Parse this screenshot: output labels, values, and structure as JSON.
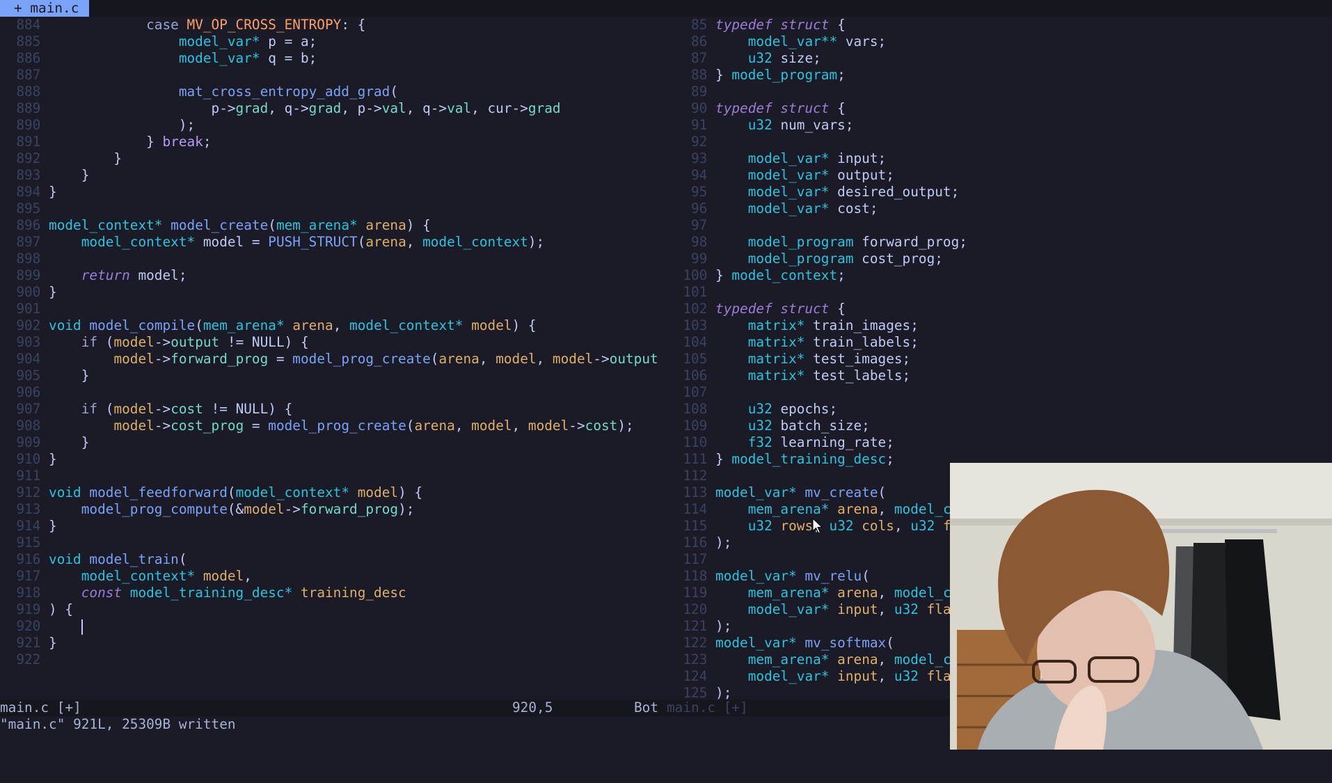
{
  "tab": {
    "label": "+ main.c"
  },
  "left_pane": {
    "lines": [
      {
        "n": "884",
        "code": "            ⟦kw|case⟧ ⟦c|MV_OP_CROSS_ENTROPY⟧: {"
      },
      {
        "n": "885",
        "code": "                ⟦t|model_var*⟧ p = a;"
      },
      {
        "n": "886",
        "code": "                ⟦t|model_var*⟧ q = b;"
      },
      {
        "n": "887",
        "code": ""
      },
      {
        "n": "888",
        "code": "                ⟦f|mat_cross_entropy_add_grad⟧("
      },
      {
        "n": "889",
        "code": "                    p->⟦m|grad⟧, q->⟦m|grad⟧, p->⟦m|val⟧, q->⟦m|val⟧, cur->⟦m|grad⟧"
      },
      {
        "n": "890",
        "code": "                );"
      },
      {
        "n": "891",
        "code": "            } ⟦b|break⟧;"
      },
      {
        "n": "892",
        "code": "        }"
      },
      {
        "n": "893",
        "code": "    }"
      },
      {
        "n": "894",
        "code": "}"
      },
      {
        "n": "895",
        "code": ""
      },
      {
        "n": "896",
        "code": "⟦t|model_context*⟧ ⟦f|model_create⟧(⟦t|mem_arena*⟧ ⟦v|arena⟧) {"
      },
      {
        "n": "897",
        "code": "    ⟦t|model_context*⟧ model = ⟦f|PUSH_STRUCT⟧(⟦v|arena⟧, ⟦t|model_context⟧);"
      },
      {
        "n": "898",
        "code": ""
      },
      {
        "n": "899",
        "code": "    ⟦k|return⟧ model;"
      },
      {
        "n": "900",
        "code": "}"
      },
      {
        "n": "901",
        "code": ""
      },
      {
        "n": "902",
        "code": "⟦t|void⟧ ⟦f|model_compile⟧(⟦t|mem_arena*⟧ ⟦v|arena⟧, ⟦t|model_context*⟧ ⟦v|model⟧) {"
      },
      {
        "n": "903",
        "code": "    ⟦kw|if⟧ (⟦v|model⟧->⟦m|output⟧ != NULL) {"
      },
      {
        "n": "904",
        "code": "        ⟦v|model⟧->⟦m|forward_prog⟧ = ⟦f|model_prog_create⟧(⟦v|arena⟧, ⟦v|model⟧, ⟦v|model⟧->⟦m|output⟧"
      },
      {
        "n": "905",
        "code": "    }"
      },
      {
        "n": "906",
        "code": ""
      },
      {
        "n": "907",
        "code": "    ⟦kw|if⟧ (⟦v|model⟧->⟦m|cost⟧ != NULL) {"
      },
      {
        "n": "908",
        "code": "        ⟦v|model⟧->⟦m|cost_prog⟧ = ⟦f|model_prog_create⟧(⟦v|arena⟧, ⟦v|model⟧, ⟦v|model⟧->⟦m|cost⟧);"
      },
      {
        "n": "909",
        "code": "    }"
      },
      {
        "n": "910",
        "code": "}"
      },
      {
        "n": "911",
        "code": ""
      },
      {
        "n": "912",
        "code": "⟦t|void⟧ ⟦f|model_feedforward⟧(⟦t|model_context*⟧ ⟦v|model⟧) {"
      },
      {
        "n": "913",
        "code": "    ⟦f|model_prog_compute⟧(&⟦v|model⟧->⟦m|forward_prog⟧);"
      },
      {
        "n": "914",
        "code": "}"
      },
      {
        "n": "915",
        "code": ""
      },
      {
        "n": "916",
        "code": "⟦t|void⟧ ⟦f|model_train⟧("
      },
      {
        "n": "917",
        "code": "    ⟦t|model_context*⟧ ⟦v|model⟧,"
      },
      {
        "n": "918",
        "code": "    ⟦k|const⟧ ⟦t|model_training_desc*⟧ ⟦v|training_desc⟧"
      },
      {
        "n": "919",
        "code": ") {"
      },
      {
        "n": "920",
        "code": "    ",
        "cursor": true
      },
      {
        "n": "921",
        "code": "}"
      },
      {
        "n": "922",
        "code": ""
      }
    ]
  },
  "right_pane": {
    "lines": [
      {
        "n": "85",
        "code": "⟦k|typedef struct⟧ {"
      },
      {
        "n": "86",
        "code": "    ⟦t|model_var**⟧ vars;"
      },
      {
        "n": "87",
        "code": "    ⟦t|u32⟧ size;"
      },
      {
        "n": "88",
        "code": "} ⟦t|model_program⟧;"
      },
      {
        "n": "89",
        "code": ""
      },
      {
        "n": "90",
        "code": "⟦k|typedef struct⟧ {"
      },
      {
        "n": "91",
        "code": "    ⟦t|u32⟧ num_vars;"
      },
      {
        "n": "92",
        "code": ""
      },
      {
        "n": "93",
        "code": "    ⟦t|model_var*⟧ input;"
      },
      {
        "n": "94",
        "code": "    ⟦t|model_var*⟧ output;"
      },
      {
        "n": "95",
        "code": "    ⟦t|model_var*⟧ desired_output;"
      },
      {
        "n": "96",
        "code": "    ⟦t|model_var*⟧ cost;"
      },
      {
        "n": "97",
        "code": ""
      },
      {
        "n": "98",
        "code": "    ⟦t|model_program⟧ forward_prog;"
      },
      {
        "n": "99",
        "code": "    ⟦t|model_program⟧ cost_prog;"
      },
      {
        "n": "100",
        "code": "} ⟦t|model_context⟧;"
      },
      {
        "n": "101",
        "code": ""
      },
      {
        "n": "102",
        "code": "⟦k|typedef struct⟧ {"
      },
      {
        "n": "103",
        "code": "    ⟦t|matrix*⟧ train_images;"
      },
      {
        "n": "104",
        "code": "    ⟦t|matrix*⟧ train_labels;"
      },
      {
        "n": "105",
        "code": "    ⟦t|matrix*⟧ test_images;"
      },
      {
        "n": "106",
        "code": "    ⟦t|matrix*⟧ test_labels;"
      },
      {
        "n": "107",
        "code": ""
      },
      {
        "n": "108",
        "code": "    ⟦t|u32⟧ epochs;"
      },
      {
        "n": "109",
        "code": "    ⟦t|u32⟧ batch_size;"
      },
      {
        "n": "110",
        "code": "    ⟦t|f32⟧ learning_rate;"
      },
      {
        "n": "111",
        "code": "} ⟦t|model_training_desc⟧;"
      },
      {
        "n": "112",
        "code": ""
      },
      {
        "n": "113",
        "code": "⟦t|model_var*⟧ ⟦f|mv_create⟧("
      },
      {
        "n": "114",
        "code": "    ⟦t|mem_arena*⟧ ⟦v|arena⟧, ⟦t|model_c⟧"
      },
      {
        "n": "115",
        "code": "    ⟦t|u32⟧ ⟦v|rows⟧, ⟦t|u32⟧ ⟦v|cols⟧, ⟦t|u32⟧ ⟦v|f⟧"
      },
      {
        "n": "116",
        "code": ");"
      },
      {
        "n": "117",
        "code": ""
      },
      {
        "n": "118",
        "code": "⟦t|model_var*⟧ ⟦f|mv_relu⟧("
      },
      {
        "n": "119",
        "code": "    ⟦t|mem_arena*⟧ ⟦v|arena⟧, ⟦t|model_c⟧"
      },
      {
        "n": "120",
        "code": "    ⟦t|model_var*⟧ ⟦v|input⟧, ⟦t|u32⟧ ⟦v|fla⟧"
      },
      {
        "n": "121",
        "code": ");"
      },
      {
        "n": "122",
        "code": "⟦t|model_var*⟧ ⟦f|mv_softmax⟧("
      },
      {
        "n": "123",
        "code": "    ⟦t|mem_arena*⟧ ⟦v|arena⟧, ⟦t|model_c⟧"
      },
      {
        "n": "124",
        "code": "    ⟦t|model_var*⟧ ⟦v|input⟧, ⟦t|u32⟧ ⟦v|fla⟧"
      },
      {
        "n": "125",
        "code": ");"
      }
    ]
  },
  "status": {
    "left_file": "main.c [+]",
    "position": "920,5",
    "scroll": "Bot",
    "right_file": "main.c [+]"
  },
  "command_line": "\"main.c\" 921L, 25309B written",
  "colors": {
    "background": "#1a1b26",
    "tab_active": "#7aa2f7",
    "type": "#2ac3de",
    "function": "#7aa2f7",
    "param": "#e0af68",
    "keyword": "#9d7cd8",
    "constant": "#ff9e64"
  },
  "icons": {
    "mouse_pointer": "arrow-pointer-icon"
  }
}
